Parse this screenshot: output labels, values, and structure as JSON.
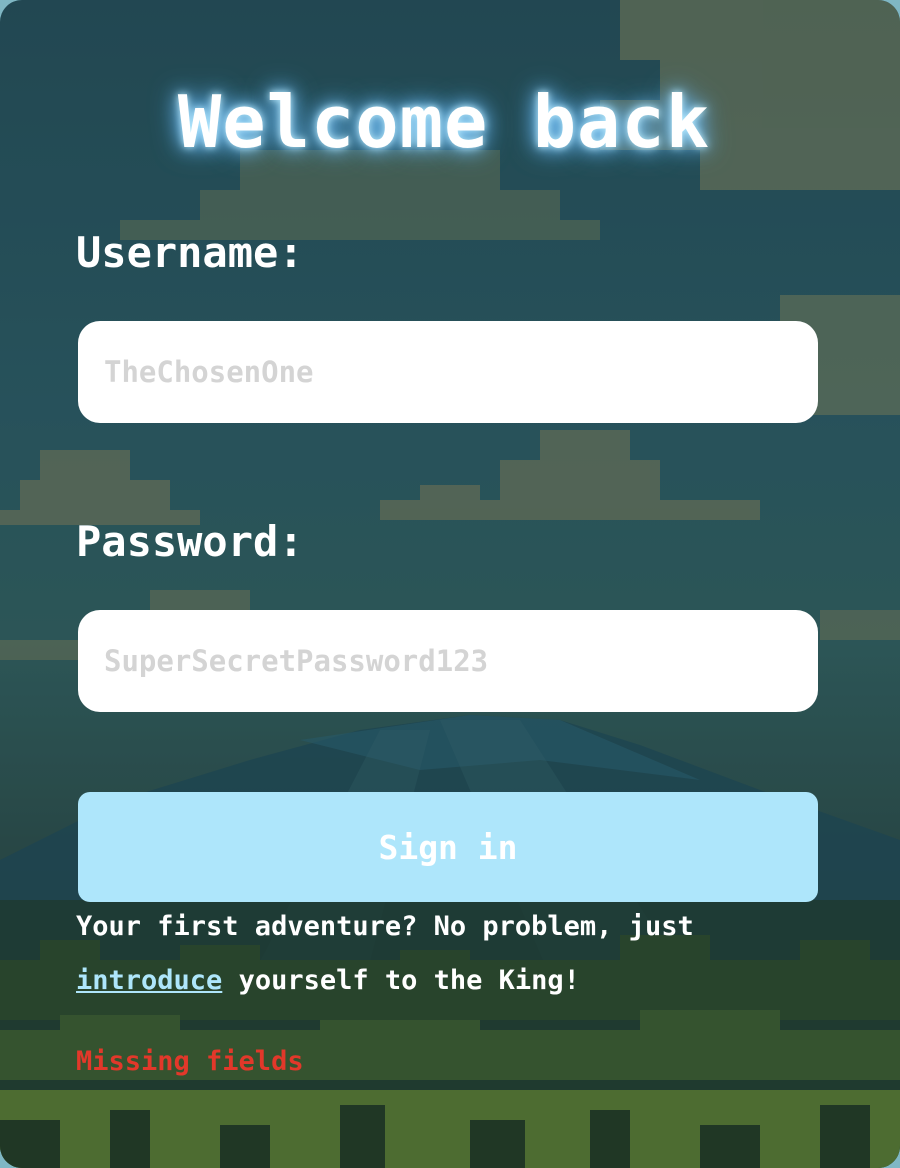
{
  "form": {
    "title": "Welcome back",
    "username_label": "Username:",
    "username_placeholder": "TheChosenOne",
    "password_label": "Password:",
    "password_placeholder": "SuperSecretPassword123",
    "signin_label": "Sign in",
    "footer_prefix": "Your first adventure? No problem, just ",
    "footer_link": "introduce",
    "footer_suffix": " yourself to the King!",
    "error_message": "Missing fields"
  },
  "colors": {
    "accent": "#aee6fb",
    "error": "#e2382a",
    "title_glow": "#7cc8ff"
  }
}
